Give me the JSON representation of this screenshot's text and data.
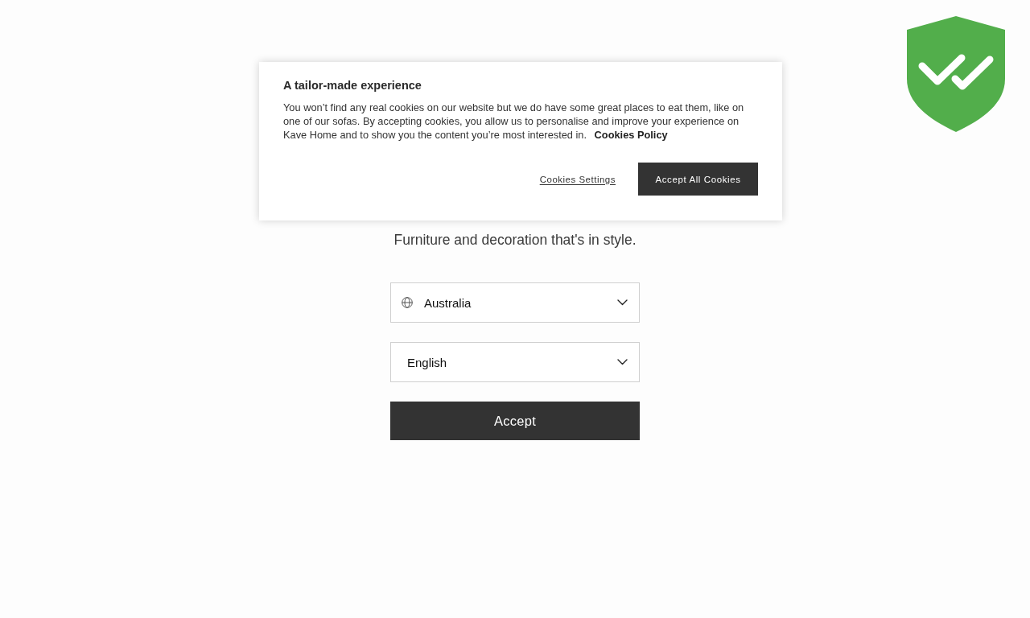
{
  "cookie_banner": {
    "title": "A tailor-made experience",
    "text": "You won’t find any real cookies on our website but we do have some great places to eat them, like on one of our sofas. By accepting cookies, you allow us to personalise and improve your experience on Kave Home and to show you the content you’re most interested in.",
    "policy_link": "Cookies Policy",
    "settings_link": "Cookies Settings",
    "accept_button": "Accept All Cookies"
  },
  "tagline": "Furniture and decoration that's in style.",
  "selects": [
    {
      "kind": "country",
      "value": "Australia"
    },
    {
      "kind": "language",
      "value": "English"
    }
  ],
  "accept_button": "Accept"
}
